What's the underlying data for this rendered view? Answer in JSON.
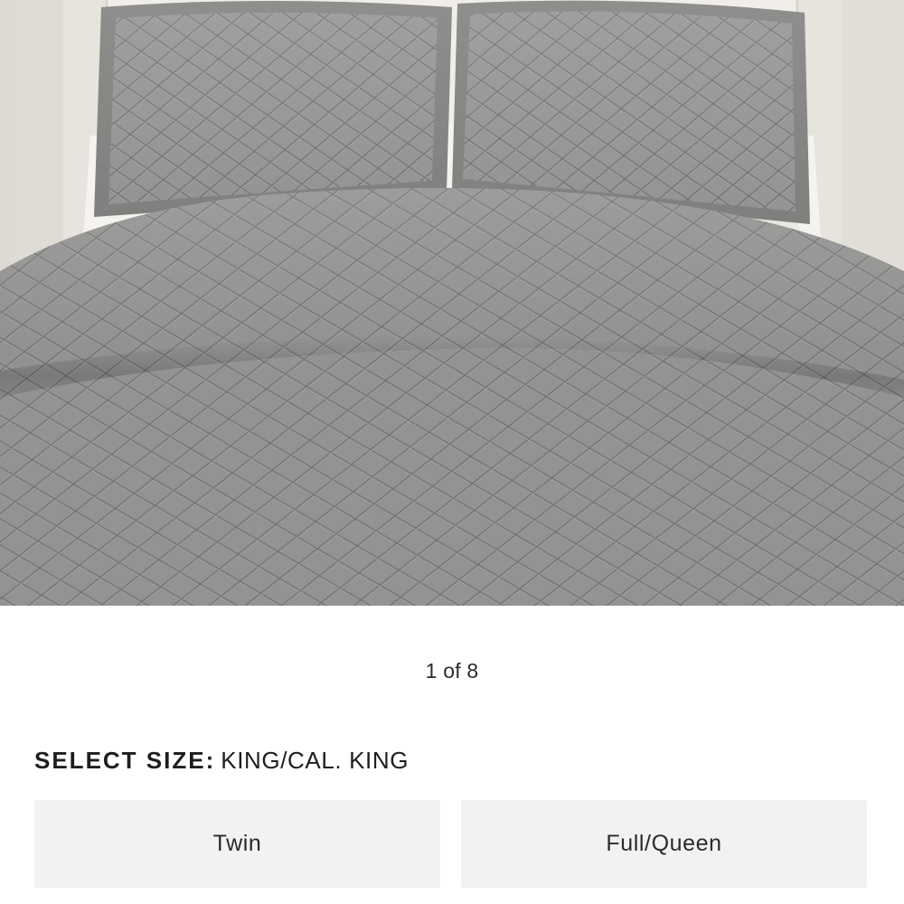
{
  "product": {
    "image_alt": "Gray diamond-quilted bedding set with two matching shams on an upholstered bed"
  },
  "carousel": {
    "counter": "1 of 8"
  },
  "size_selector": {
    "label": "SELECT SIZE:",
    "selected_value": "KING/CAL. KING",
    "options": [
      {
        "label": "Twin"
      },
      {
        "label": "Full/Queen"
      }
    ]
  },
  "colors": {
    "quilt": "#8d8d8c",
    "option_background": "#f3f2f0",
    "text": "#1e1e1e"
  }
}
